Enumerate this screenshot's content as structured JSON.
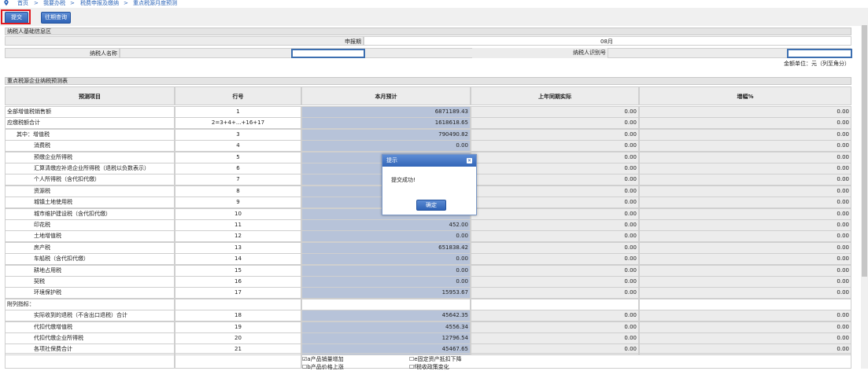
{
  "breadcrumb": [
    "首页",
    "我要办税",
    "税费申报及缴纳",
    "重点税源月度预测"
  ],
  "breadcrumb_sep": ">",
  "toolbar": {
    "submit_label": "提交",
    "history_label": "往期查询"
  },
  "basic_info": {
    "section_title": "纳税人基础信息区",
    "period_label": "申报期",
    "period_value": "08月",
    "name_label": "纳税人名称",
    "name_value": "",
    "id_label": "纳税人识别号",
    "id_value": "",
    "unit_label": "金额单位：元（列至角分）"
  },
  "table": {
    "section_title": "重点税源企业纳税预测表",
    "headers": [
      "预测项目",
      "行号",
      "本月预计",
      "上年同期实际",
      "增幅%"
    ],
    "rows": [
      {
        "item": "全部增值税销售额",
        "line": "1",
        "est": "6871189.43",
        "last": "0.00",
        "growth": "0.00"
      },
      {
        "item": "应缴税额合计",
        "line": "2=3+4+...+16+17",
        "est": "1618618.65",
        "last": "0.00",
        "growth": "0.00"
      },
      {
        "item": "其中：增值税",
        "line": "3",
        "est": "790490.82",
        "last": "0.00",
        "growth": "0.00"
      },
      {
        "item": "消费税",
        "line": "4",
        "est": "0.00",
        "last": "0.00",
        "growth": "0.00"
      },
      {
        "item": "预缴企业所得税",
        "line": "5",
        "est": "",
        "last": "0.00",
        "growth": "0.00"
      },
      {
        "item": "汇算清缴应补退企业所得税（退税以负数表示）",
        "line": "6",
        "est": "",
        "last": "0.00",
        "growth": "0.00"
      },
      {
        "item": "个人所得税（含代扣代缴）",
        "line": "7",
        "est": "",
        "last": "0.00",
        "growth": "0.00"
      },
      {
        "item": "资源税",
        "line": "8",
        "est": "",
        "last": "0.00",
        "growth": "0.00"
      },
      {
        "item": "城镇土地使用税",
        "line": "9",
        "est": "",
        "last": "0.00",
        "growth": "0.00"
      },
      {
        "item": "城市维护建设税（含代扣代缴）",
        "line": "10",
        "est": "",
        "last": "0.00",
        "growth": "0.00"
      },
      {
        "item": "印花税",
        "line": "11",
        "est": "452.00",
        "last": "0.00",
        "growth": "0.00"
      },
      {
        "item": "土地增值税",
        "line": "12",
        "est": "0.00",
        "last": "0.00",
        "growth": "0.00"
      },
      {
        "item": "房产税",
        "line": "13",
        "est": "651838.42",
        "last": "0.00",
        "growth": "0.00"
      },
      {
        "item": "车船税（含代扣代缴）",
        "line": "14",
        "est": "0.00",
        "last": "0.00",
        "growth": "0.00"
      },
      {
        "item": "耕地占用税",
        "line": "15",
        "est": "0.00",
        "last": "0.00",
        "growth": "0.00"
      },
      {
        "item": "契税",
        "line": "16",
        "est": "0.00",
        "last": "0.00",
        "growth": "0.00"
      },
      {
        "item": "环境保护税",
        "line": "17",
        "est": "15953.67",
        "last": "0.00",
        "growth": "0.00"
      }
    ],
    "appendix_label": "附列指标：",
    "appendix_rows": [
      {
        "item": "实际收到的退税（不含出口退税）合计",
        "line": "18",
        "est": "45642.35",
        "last": "0.00",
        "growth": "0.00"
      },
      {
        "item": "代扣代缴增值税",
        "line": "19",
        "est": "4556.34",
        "last": "0.00",
        "growth": "0.00"
      },
      {
        "item": "代扣代缴企业所得税",
        "line": "20",
        "est": "12796.54",
        "last": "0.00",
        "growth": "0.00"
      },
      {
        "item": "各项社保费合计",
        "line": "21",
        "est": "45467.65",
        "last": "0.00",
        "growth": "0.00"
      }
    ],
    "checkbox_options": [
      "a产品销量增加",
      "e固定资产抵扣下降",
      "b产品价格上涨",
      "f税收政策变化"
    ],
    "checkbox_checked": [
      true,
      false,
      false,
      false
    ]
  },
  "dialog": {
    "title": "提示",
    "message": "提交成功!",
    "ok_label": "确定"
  },
  "colors": {
    "accent": "#3366b8",
    "highlight": "#e1181e",
    "input_fill": "#b7c3d9"
  }
}
